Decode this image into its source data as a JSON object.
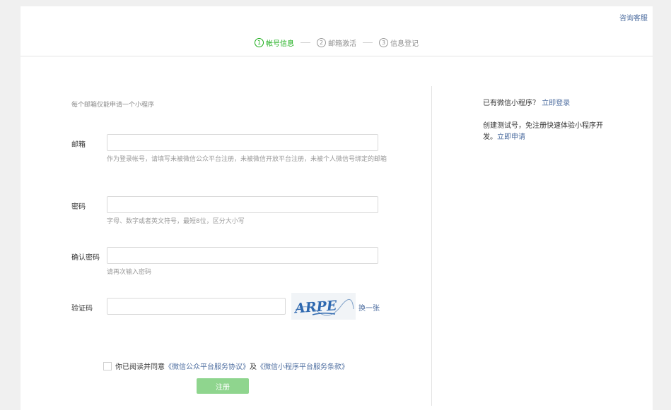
{
  "header": {
    "help_link": "咨询客服",
    "steps": [
      {
        "number": "1",
        "label": "帐号信息",
        "active": true
      },
      {
        "number": "2",
        "label": "邮箱激活",
        "active": false
      },
      {
        "number": "3",
        "label": "信息登记",
        "active": false
      }
    ]
  },
  "form": {
    "intro": "每个邮箱仅能申请一个小程序",
    "email": {
      "label": "邮箱",
      "value": "",
      "hint": "作为登录帐号，请填写未被微信公众平台注册，未被微信开放平台注册，未被个人微信号绑定的邮箱"
    },
    "password": {
      "label": "密码",
      "value": "",
      "hint": "字母、数字或者英文符号，最短8位，区分大小写"
    },
    "confirm_password": {
      "label": "确认密码",
      "value": "",
      "hint": "请再次输入密码"
    },
    "captcha": {
      "label": "验证码",
      "value": "",
      "image_text": "ARPE",
      "refresh": "换一张"
    },
    "agreement": {
      "prefix": "你已阅读并同意",
      "link1": "《微信公众平台服务协议》",
      "middle": "及",
      "link2": "《微信小程序平台服务条款》",
      "checked": false
    },
    "submit_label": "注册"
  },
  "sidebar": {
    "login_prompt": "已有微信小程序？",
    "login_link": "立即登录",
    "test_text": "创建测试号，免注册快速体验小程序开发。",
    "test_link": "立即申请"
  },
  "colors": {
    "accent_green": "#1aad19",
    "link_blue": "#4e6ea0",
    "disabled_button": "#8fd58e"
  }
}
